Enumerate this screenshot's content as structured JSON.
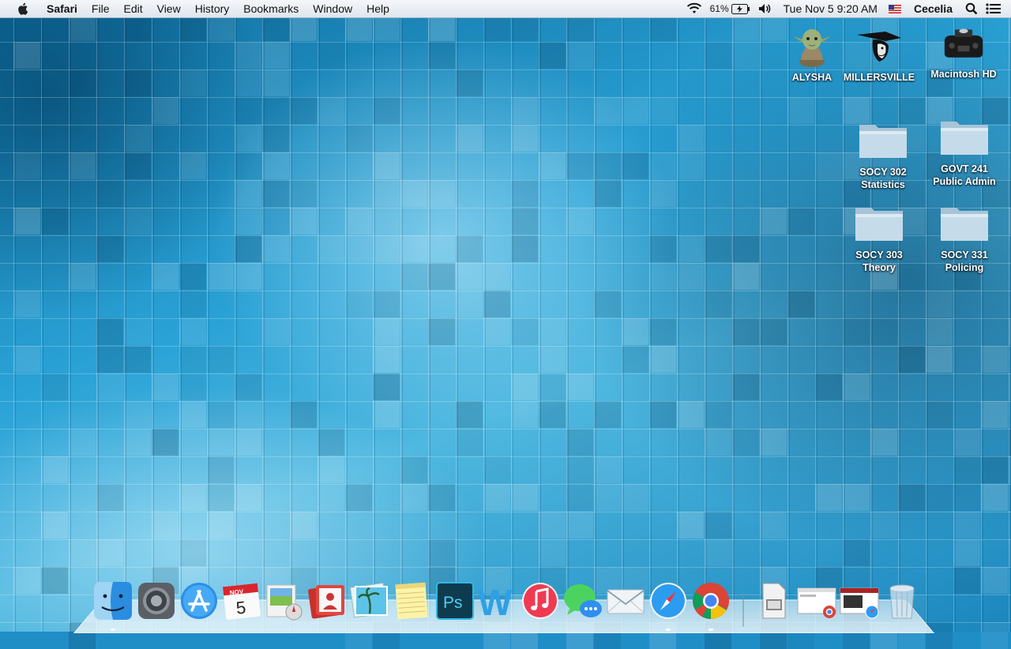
{
  "menubar": {
    "app_name": "Safari",
    "menus": [
      "File",
      "Edit",
      "View",
      "History",
      "Bookmarks",
      "Window",
      "Help"
    ],
    "battery_percent": "61%",
    "datetime": "Tue Nov 5  9:20 AM",
    "user": "Cecelia",
    "icons": [
      "apple-icon",
      "wifi-icon",
      "battery-icon",
      "volume-icon",
      "flag-icon",
      "spotlight-icon",
      "notification-center-icon"
    ]
  },
  "desktop": {
    "icons": [
      {
        "label": "ALYSHA",
        "icon": "yoda-drive-icon"
      },
      {
        "label": "MILLERSVILLE",
        "icon": "millersville-drive-icon"
      },
      {
        "label": "Macintosh HD",
        "icon": "hard-drive-icon"
      },
      {
        "label": "SOCY 302\nStatistics",
        "line1": "SOCY 302",
        "line2": "Statistics",
        "icon": "folder-icon"
      },
      {
        "label": "GOVT 241 Public Admin",
        "line1": "GOVT 241",
        "line2": "Public Admin",
        "icon": "folder-icon"
      },
      {
        "label": "SOCY 303 Theory",
        "line1": "SOCY 303",
        "line2": "Theory",
        "icon": "folder-icon"
      },
      {
        "label": "SOCY 331 Policing",
        "line1": "SOCY 331",
        "line2": "Policing",
        "icon": "folder-icon"
      }
    ]
  },
  "dock": {
    "apps": [
      "finder-icon",
      "system-preferences-icon",
      "app-store-icon",
      "calendar-icon",
      "preview-icon",
      "photo-booth-icon",
      "iphoto-icon",
      "notes-icon",
      "photoshop-icon",
      "word-icon",
      "itunes-icon",
      "messages-icon",
      "mail-icon",
      "safari-icon",
      "chrome-icon"
    ],
    "calendar_month": "NOV",
    "calendar_day": "5",
    "photoshop_label": "Ps",
    "word_label": "W",
    "right_items": [
      "script-document-icon",
      "chrome-window-thumbnail-icon",
      "safari-window-thumbnail-icon",
      "trash-icon"
    ]
  },
  "colors": {
    "wallpaper_base": "#1f8ec7",
    "wallpaper_light": "#bfeaf9",
    "wallpaper_dark": "#0a5f8c"
  }
}
